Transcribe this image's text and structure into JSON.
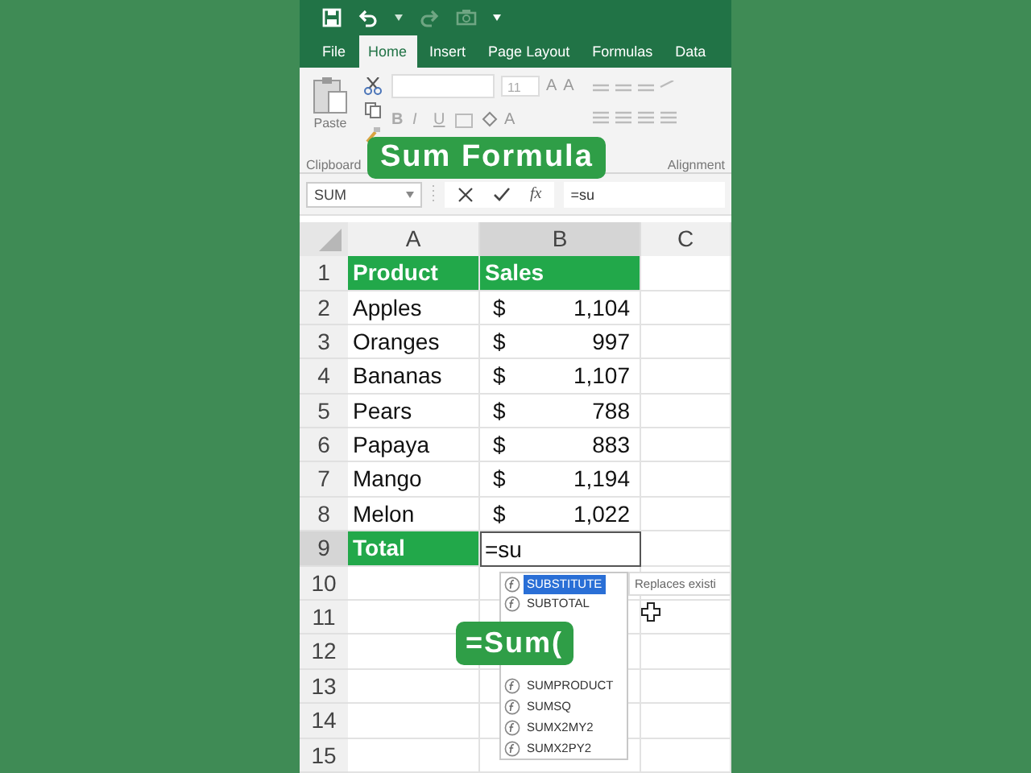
{
  "tabs": [
    {
      "label": "File",
      "selected": false
    },
    {
      "label": "Home",
      "selected": true
    },
    {
      "label": "Insert",
      "selected": false
    },
    {
      "label": "Page Layout",
      "selected": false
    },
    {
      "label": "Formulas",
      "selected": false
    },
    {
      "label": "Data",
      "selected": false
    }
  ],
  "ribbon": {
    "paste_label": "Paste",
    "font_size": "11",
    "size_buttons": [
      "A",
      "A"
    ],
    "format_buttons": [
      "B",
      "I",
      "U"
    ],
    "font_color_button": "A",
    "group_labels": [
      "Clipboard",
      "Alignment"
    ]
  },
  "title_badge": "Sum Formula",
  "formula_bar": {
    "name_box": "SUM",
    "function_button": "fx",
    "value": "=su"
  },
  "columns": [
    {
      "label": "A",
      "selected": false
    },
    {
      "label": "B",
      "selected": true
    },
    {
      "label": "C",
      "selected": false
    }
  ],
  "rows": [
    {
      "number": "1",
      "selected": false,
      "kind": "header",
      "cells": [
        "Product",
        "Sales"
      ]
    },
    {
      "number": "2",
      "selected": false,
      "kind": "data",
      "cells": [
        "Apples",
        "$",
        "1,104"
      ]
    },
    {
      "number": "3",
      "selected": false,
      "kind": "data",
      "cells": [
        "Oranges",
        "$",
        "997"
      ]
    },
    {
      "number": "4",
      "selected": false,
      "kind": "data",
      "cells": [
        "Bananas",
        "$",
        "1,107"
      ]
    },
    {
      "number": "5",
      "selected": false,
      "kind": "data",
      "cells": [
        "Pears",
        "$",
        "788"
      ]
    },
    {
      "number": "6",
      "selected": false,
      "kind": "data",
      "cells": [
        "Papaya",
        "$",
        "883"
      ]
    },
    {
      "number": "7",
      "selected": false,
      "kind": "data",
      "cells": [
        "Mango",
        "$",
        "1,194"
      ]
    },
    {
      "number": "8",
      "selected": false,
      "kind": "data",
      "cells": [
        "Melon",
        "$",
        "1,022"
      ]
    },
    {
      "number": "9",
      "selected": true,
      "kind": "total",
      "cells": [
        "Total",
        "=su"
      ]
    },
    {
      "number": "10",
      "selected": false,
      "kind": "empty",
      "cells": []
    },
    {
      "number": "11",
      "selected": false,
      "kind": "empty",
      "cells": []
    },
    {
      "number": "12",
      "selected": false,
      "kind": "empty",
      "cells": []
    },
    {
      "number": "13",
      "selected": false,
      "kind": "empty",
      "cells": []
    },
    {
      "number": "14",
      "selected": false,
      "kind": "empty",
      "cells": []
    },
    {
      "number": "15",
      "selected": false,
      "kind": "empty",
      "cells": []
    }
  ],
  "autocomplete": {
    "items": [
      {
        "label": "SUBSTITUTE",
        "selected": true
      },
      {
        "label": "SUBTOTAL",
        "selected": false
      },
      {
        "label": "SUMPRODUCT",
        "selected": false
      },
      {
        "label": "SUMSQ",
        "selected": false
      },
      {
        "label": "SUMX2MY2",
        "selected": false
      },
      {
        "label": "SUMX2PY2",
        "selected": false
      }
    ],
    "tooltip": "Replaces existi"
  },
  "caption_badge": "=Sum("
}
